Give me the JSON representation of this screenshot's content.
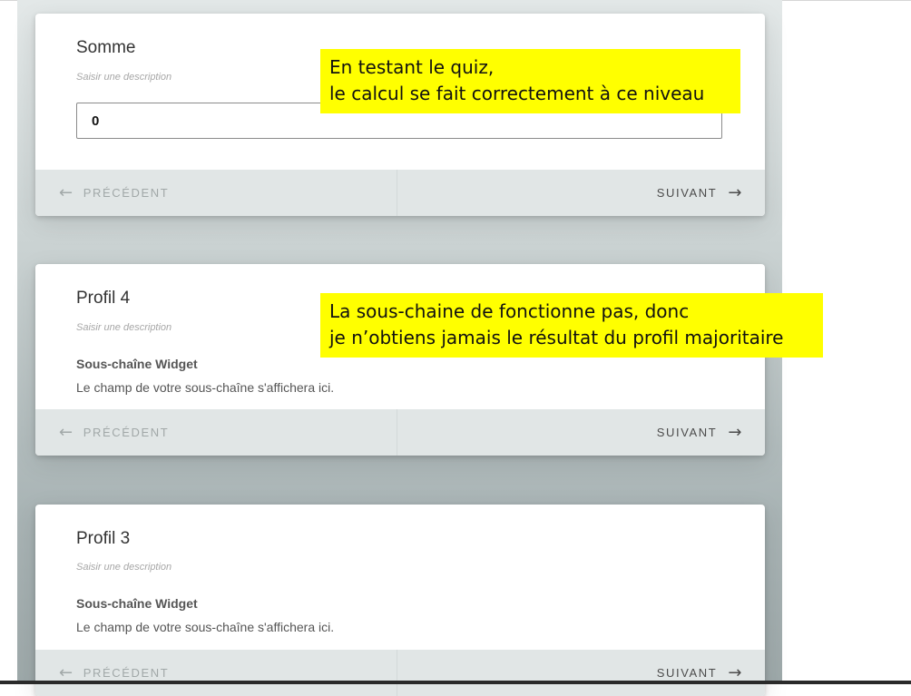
{
  "cards": [
    {
      "title": "Somme",
      "description_placeholder": "Saisir une description",
      "input_value": "0",
      "prev_label": "PRÉCÉDENT",
      "next_label": "SUIVANT"
    },
    {
      "title": "Profil 4",
      "description_placeholder": "Saisir une description",
      "widget_title": "Sous-chaîne Widget",
      "widget_text": "Le champ de votre sous-chaîne s'affichera ici.",
      "prev_label": "PRÉCÉDENT",
      "next_label": "SUIVANT"
    },
    {
      "title": "Profil 3",
      "description_placeholder": "Saisir une description",
      "widget_title": "Sous-chaîne Widget",
      "widget_text": "Le champ de votre sous-chaîne s'affichera ici.",
      "prev_label": "PRÉCÉDENT",
      "next_label": "SUIVANT"
    }
  ],
  "annotations": [
    {
      "line1": "En testant le quiz,",
      "line2": "le calcul se fait correctement à ce niveau"
    },
    {
      "line1": "La sous-chaine de fonctionne pas, donc",
      "line2": "je n’obtiens jamais le résultat du profil majoritaire"
    }
  ],
  "icons": {
    "prev": "arrow-left-icon",
    "next": "arrow-right-icon"
  },
  "colors": {
    "annotation_bg": "#ffff00",
    "footer_bg": "#e1e6e6"
  }
}
